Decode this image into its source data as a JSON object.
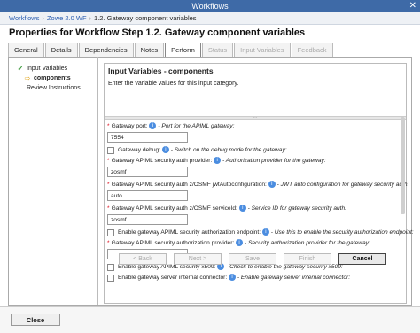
{
  "window": {
    "title": "Workflows",
    "close_glyph": "✕"
  },
  "breadcrumbs": [
    "Workflows",
    "Zowe 2.0 WF",
    "1.2. Gateway component variables"
  ],
  "heading": "Properties for Workflow Step 1.2. Gateway component variables",
  "tabs": [
    {
      "label": "General",
      "state": "normal"
    },
    {
      "label": "Details",
      "state": "normal"
    },
    {
      "label": "Dependencies",
      "state": "normal"
    },
    {
      "label": "Notes",
      "state": "normal"
    },
    {
      "label": "Perform",
      "state": "active"
    },
    {
      "label": "Status",
      "state": "disabled"
    },
    {
      "label": "Input Variables",
      "state": "disabled"
    },
    {
      "label": "Feedback",
      "state": "disabled"
    }
  ],
  "nav": [
    {
      "label": "Input Variables",
      "icon": "check-icon"
    },
    {
      "label": "components",
      "icon": "arrow-right-icon"
    },
    {
      "label": "Review Instructions",
      "icon": ""
    }
  ],
  "panel": {
    "title": "Input Variables - components",
    "description": "Enter the variable values for this input category."
  },
  "fields": [
    {
      "kind": "input",
      "required": true,
      "label": "Gateway port:",
      "hint": "- Port for the APIML gateway:",
      "value": "7554"
    },
    {
      "kind": "checkbox",
      "required": false,
      "label": "Gateway debug:",
      "hint": "- Switch on the debug mode for the gateway:",
      "checked": false
    },
    {
      "kind": "input",
      "required": true,
      "label": "Gateway APIML security auth provider:",
      "hint": "- Authorization provider for the gateway:",
      "value": "zosmf"
    },
    {
      "kind": "input",
      "required": true,
      "label": "Gateway APIML security auth z/OSMF jwtAutoconfiguration:",
      "hint": "- JWT auto configuration for gateway security auth:",
      "value": "auto"
    },
    {
      "kind": "input",
      "required": true,
      "label": "Gateway APIML security auth z/OSMF serviceId:",
      "hint": "- Service ID for gateway security auth:",
      "value": "zosmf"
    },
    {
      "kind": "checkbox",
      "required": false,
      "label": "Enable gateway APIML security authorization endpoint:",
      "hint": "- Use this to enable the security authorization endpoint:",
      "checked": false
    },
    {
      "kind": "input",
      "required": true,
      "label": "Gateway APIML security authorization provider:",
      "hint": "- Security authorization provider for the gateway:",
      "value": ""
    },
    {
      "kind": "checkbox",
      "required": false,
      "label": "Enable gateway APIML security x509:",
      "hint": "- Check to enable the gateway security x509:",
      "checked": false
    },
    {
      "kind": "checkbox",
      "required": false,
      "label": "Enable gateway server internal connector:",
      "hint": "- Enable gateway server internal connector:",
      "checked": false
    }
  ],
  "buttons": {
    "back": "< Back",
    "next": "Next >",
    "save": "Save",
    "finish": "Finish",
    "cancel": "Cancel"
  },
  "footer": {
    "close": "Close"
  },
  "colors": {
    "titlebar": "#3e6aa7",
    "link": "#2a5db0",
    "required": "#d01",
    "help_icon": "#4b8de0"
  }
}
